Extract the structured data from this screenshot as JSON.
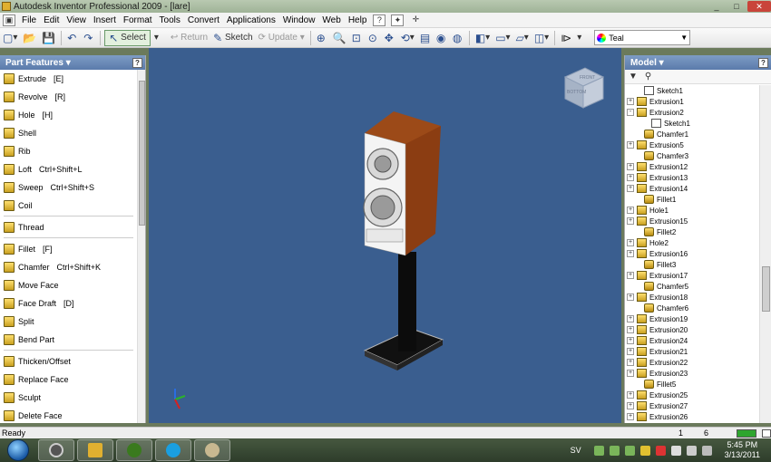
{
  "window": {
    "title": "Autodesk Inventor Professional 2009 - [lare]",
    "buttons": [
      "_",
      "□",
      "✕"
    ]
  },
  "menubar": {
    "items": [
      "File",
      "Edit",
      "View",
      "Insert",
      "Format",
      "Tools",
      "Convert",
      "Applications",
      "Window",
      "Web",
      "Help"
    ]
  },
  "toolbar": {
    "select_label": "Select",
    "return_label": "Return",
    "sketch_label": "Sketch",
    "update_label": "Update",
    "color_style": "Teal"
  },
  "left_panel": {
    "title": "Part Features ▾",
    "features": [
      {
        "label": "Extrude",
        "key": "[E]"
      },
      {
        "label": "Revolve",
        "key": "[R]"
      },
      {
        "label": "Hole",
        "key": "[H]"
      },
      {
        "label": "Shell",
        "key": ""
      },
      {
        "label": "Rib",
        "key": ""
      },
      {
        "label": "Loft",
        "key": "Ctrl+Shift+L"
      },
      {
        "label": "Sweep",
        "key": "Ctrl+Shift+S"
      },
      {
        "label": "Coil",
        "key": ""
      },
      {
        "label": "Thread",
        "key": ""
      },
      {
        "label": "Fillet",
        "key": "[F]"
      },
      {
        "label": "Chamfer",
        "key": "Ctrl+Shift+K"
      },
      {
        "label": "Move Face",
        "key": ""
      },
      {
        "label": "Face Draft",
        "key": "[D]"
      },
      {
        "label": "Split",
        "key": ""
      },
      {
        "label": "Bend Part",
        "key": ""
      },
      {
        "label": "Thicken/Offset",
        "key": ""
      },
      {
        "label": "Replace Face",
        "key": ""
      },
      {
        "label": "Sculpt",
        "key": ""
      },
      {
        "label": "Delete Face",
        "key": ""
      }
    ]
  },
  "viewcube": {
    "face_top": "FRONT",
    "face_side": "BOTTOM"
  },
  "right_panel": {
    "title": "Model ▾",
    "tree": [
      {
        "label": "Sketch1",
        "indent": 1,
        "icon": "sketch",
        "exp": ""
      },
      {
        "label": "Extrusion1",
        "indent": 0,
        "icon": "ext",
        "exp": "+"
      },
      {
        "label": "Extrusion2",
        "indent": 0,
        "icon": "ext",
        "exp": "-"
      },
      {
        "label": "Sketch1",
        "indent": 2,
        "icon": "sketch",
        "exp": ""
      },
      {
        "label": "Chamfer1",
        "indent": 1,
        "icon": "chamfer",
        "exp": ""
      },
      {
        "label": "Extrusion5",
        "indent": 0,
        "icon": "ext",
        "exp": "+"
      },
      {
        "label": "Chamfer3",
        "indent": 1,
        "icon": "chamfer",
        "exp": ""
      },
      {
        "label": "Extrusion12",
        "indent": 0,
        "icon": "ext",
        "exp": "+"
      },
      {
        "label": "Extrusion13",
        "indent": 0,
        "icon": "ext",
        "exp": "+"
      },
      {
        "label": "Extrusion14",
        "indent": 0,
        "icon": "ext",
        "exp": "+"
      },
      {
        "label": "Fillet1",
        "indent": 1,
        "icon": "chamfer",
        "exp": ""
      },
      {
        "label": "Hole1",
        "indent": 0,
        "icon": "ext",
        "exp": "+"
      },
      {
        "label": "Extrusion15",
        "indent": 0,
        "icon": "ext",
        "exp": "+"
      },
      {
        "label": "Fillet2",
        "indent": 1,
        "icon": "chamfer",
        "exp": ""
      },
      {
        "label": "Hole2",
        "indent": 0,
        "icon": "ext",
        "exp": "+"
      },
      {
        "label": "Extrusion16",
        "indent": 0,
        "icon": "ext",
        "exp": "+"
      },
      {
        "label": "Fillet3",
        "indent": 1,
        "icon": "chamfer",
        "exp": ""
      },
      {
        "label": "Extrusion17",
        "indent": 0,
        "icon": "ext",
        "exp": "+"
      },
      {
        "label": "Chamfer5",
        "indent": 1,
        "icon": "chamfer",
        "exp": ""
      },
      {
        "label": "Extrusion18",
        "indent": 0,
        "icon": "ext",
        "exp": "+"
      },
      {
        "label": "Chamfer6",
        "indent": 1,
        "icon": "chamfer",
        "exp": ""
      },
      {
        "label": "Extrusion19",
        "indent": 0,
        "icon": "ext",
        "exp": "+"
      },
      {
        "label": "Extrusion20",
        "indent": 0,
        "icon": "ext",
        "exp": "+"
      },
      {
        "label": "Extrusion24",
        "indent": 0,
        "icon": "ext",
        "exp": "+"
      },
      {
        "label": "Extrusion21",
        "indent": 0,
        "icon": "ext",
        "exp": "+"
      },
      {
        "label": "Extrusion22",
        "indent": 0,
        "icon": "ext",
        "exp": "+"
      },
      {
        "label": "Extrusion23",
        "indent": 0,
        "icon": "ext",
        "exp": "+"
      },
      {
        "label": "Fillet5",
        "indent": 1,
        "icon": "chamfer",
        "exp": ""
      },
      {
        "label": "Extrusion25",
        "indent": 0,
        "icon": "ext",
        "exp": "+"
      },
      {
        "label": "Extrusion27",
        "indent": 0,
        "icon": "ext",
        "exp": "+"
      },
      {
        "label": "Extrusion26",
        "indent": 0,
        "icon": "ext",
        "exp": "+"
      }
    ]
  },
  "statusbar": {
    "text": "Ready",
    "num1": "1",
    "num2": "6"
  },
  "taskbar": {
    "lang": "SV",
    "time": "5:45 PM",
    "date": "3/13/2011"
  },
  "colors": {
    "viewport_bg": "#3a5e8f",
    "wood": "#8b3d12",
    "panel_head": "#6a89b8"
  }
}
